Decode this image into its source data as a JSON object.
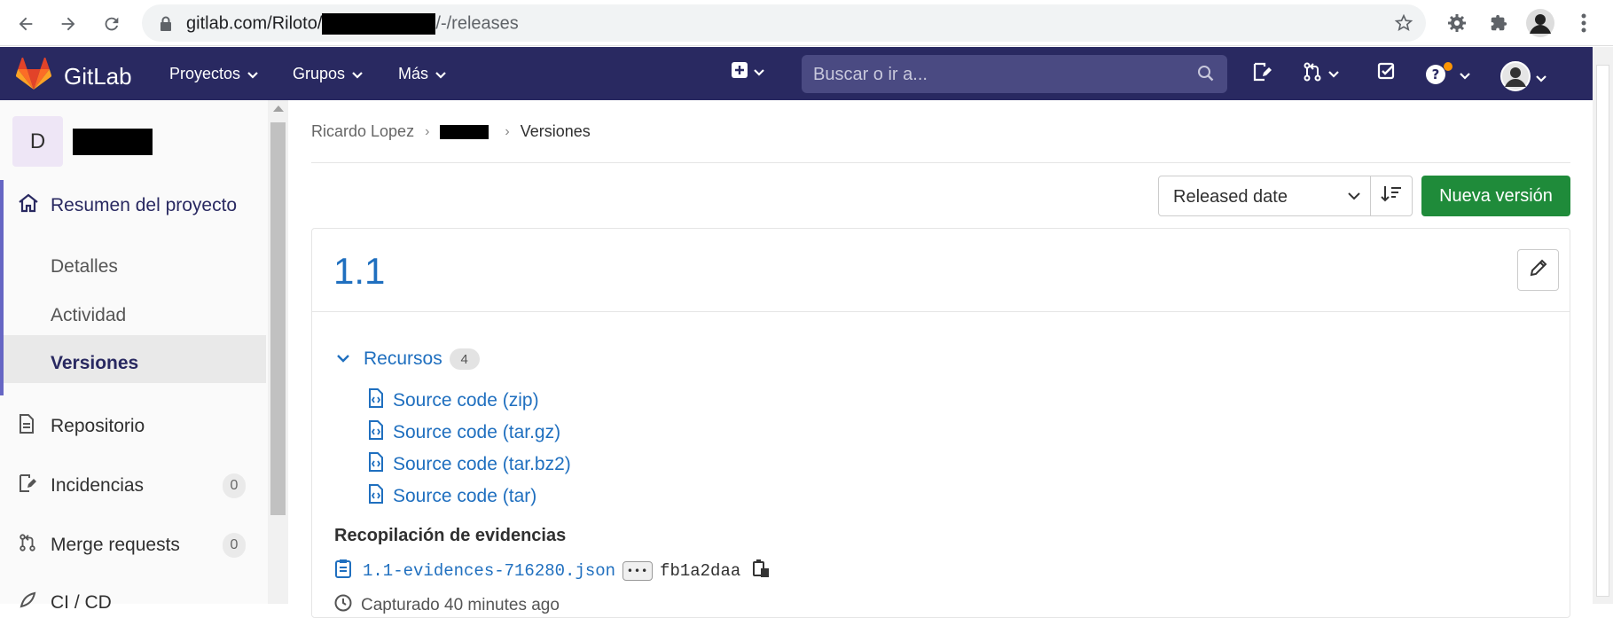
{
  "browser": {
    "url_prefix": "gitlab.com/Riloto/",
    "url_suffix": "/-/releases"
  },
  "navbar": {
    "brand": "GitLab",
    "menus": [
      "Proyectos",
      "Grupos",
      "Más"
    ],
    "search_placeholder": "Buscar o ir a..."
  },
  "sidebar": {
    "project_initial": "D",
    "overview": "Resumen del proyecto",
    "sub_items": [
      "Detalles",
      "Actividad",
      "Versiones"
    ],
    "items": [
      {
        "label": "Repositorio"
      },
      {
        "label": "Incidencias",
        "count": "0"
      },
      {
        "label": "Merge requests",
        "count": "0"
      },
      {
        "label": "CI / CD"
      }
    ]
  },
  "breadcrumb": {
    "owner": "Ricardo Lopez",
    "current": "Versiones"
  },
  "toolbar": {
    "sort_value": "Released date",
    "new_release": "Nueva versión"
  },
  "release": {
    "title": "1.1",
    "assets_label": "Recursos",
    "assets_count": "4",
    "assets": [
      "Source code (zip)",
      "Source code (tar.gz)",
      "Source code (tar.bz2)",
      "Source code (tar)"
    ],
    "evidence_title": "Recopilación de evidencias",
    "evidence_file": "1.1-evidences-716280.json",
    "evidence_hash": "fb1a2daa",
    "collected": "Capturado 40 minutes ago"
  }
}
